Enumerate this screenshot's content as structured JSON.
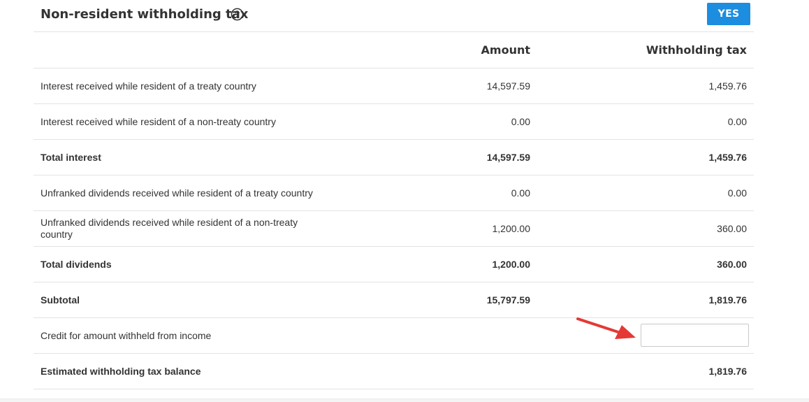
{
  "section": {
    "title": "Non-resident withholding tax",
    "toggle_label": "YES"
  },
  "columns": {
    "amount": "Amount",
    "withholding_tax": "Withholding tax"
  },
  "rows": [
    {
      "label": "Interest received while resident of a treaty country",
      "amount": "14,597.59",
      "tax": "1,459.76"
    },
    {
      "label": "Interest received while resident of a non-treaty country",
      "amount": "0.00",
      "tax": "0.00"
    },
    {
      "label": "Total interest",
      "amount": "14,597.59",
      "tax": "1,459.76"
    },
    {
      "label": "Unfranked dividends received while resident of a treaty country",
      "amount": "0.00",
      "tax": "0.00"
    },
    {
      "label": "Unfranked dividends received while resident of a non-treaty country",
      "amount": "1,200.00",
      "tax": "360.00"
    },
    {
      "label": "Total dividends",
      "amount": "1,200.00",
      "tax": "360.00"
    },
    {
      "label": "Subtotal",
      "amount": "15,797.59",
      "tax": "1,819.76"
    },
    {
      "label": "Credit for amount withheld from income",
      "input_value": ""
    },
    {
      "label": "Estimated withholding tax balance",
      "tax": "1,819.76"
    }
  ],
  "colors": {
    "accent": "#1d8ddf",
    "annotation_arrow": "#e53935"
  },
  "icons": {
    "help": "help-circle-icon",
    "arrow": "red-arrow-annotation"
  }
}
